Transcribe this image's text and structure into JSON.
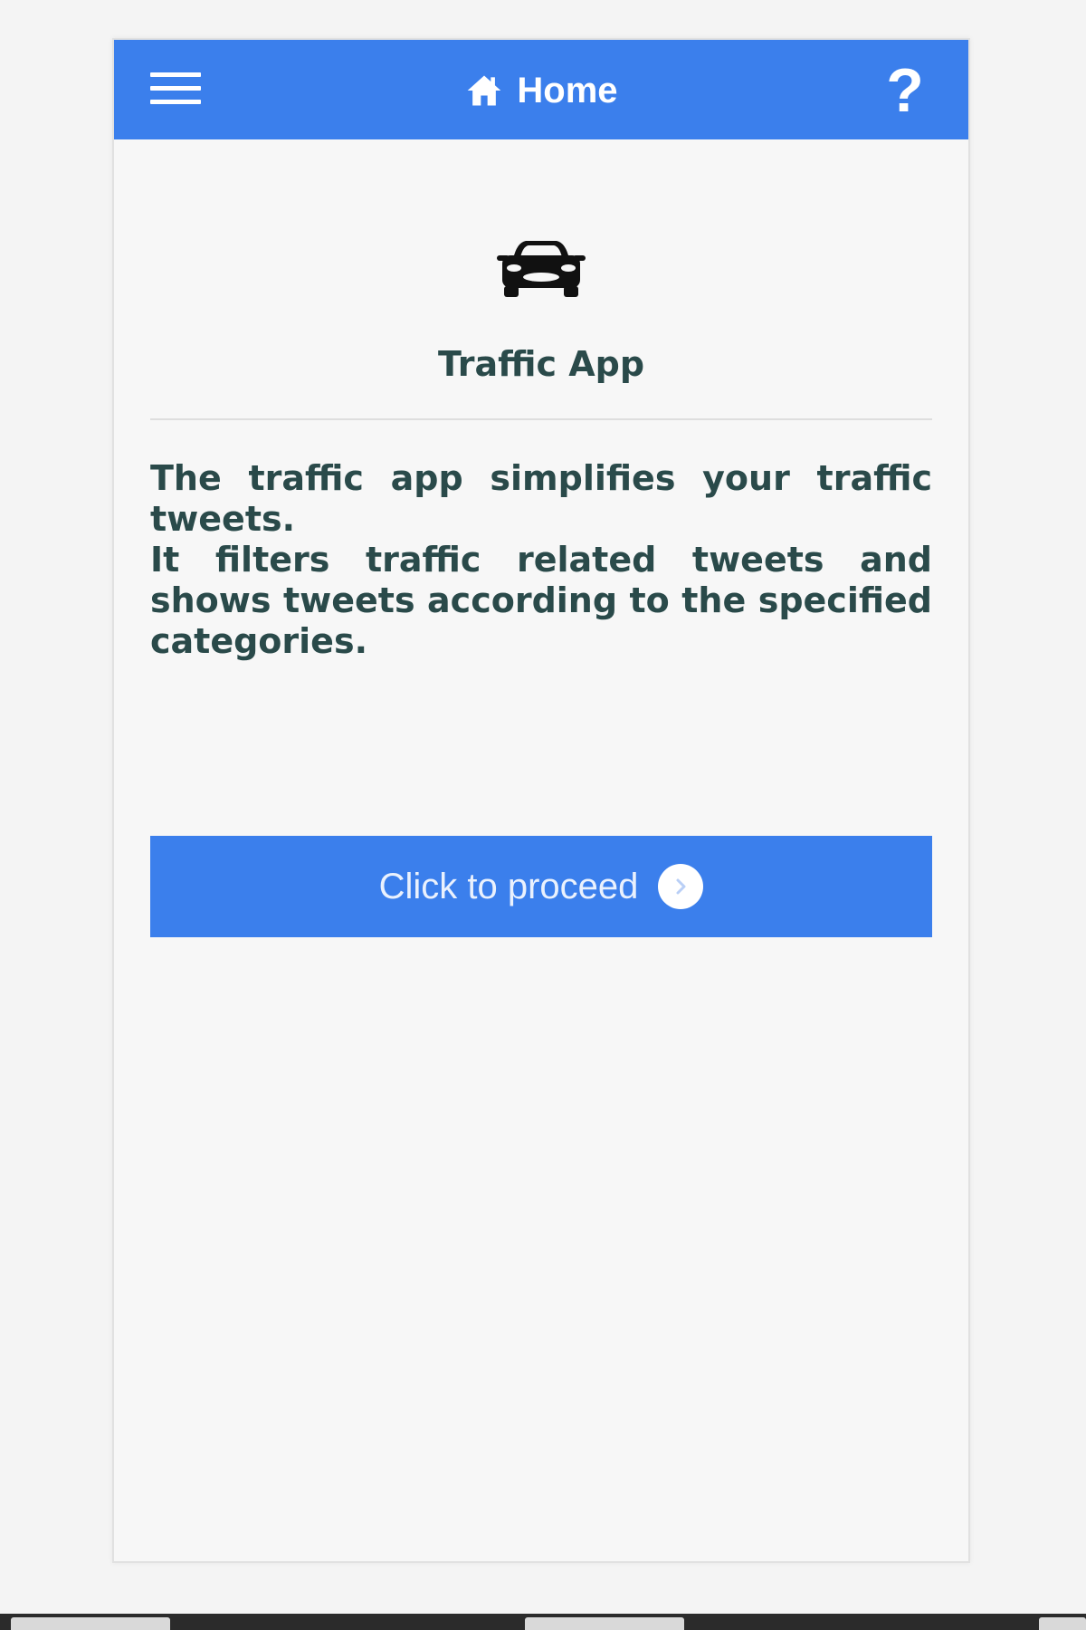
{
  "header": {
    "menu_icon": "hamburger-menu-icon",
    "home_icon": "home-icon",
    "title": "Home",
    "help_label": "?"
  },
  "main": {
    "app_icon": "car-icon",
    "app_title": "Traffic App",
    "description_lines": [
      "The traffic app simplifies your traffic tweets.",
      "It filters traffic related tweets and shows tweets according to the specified categories."
    ],
    "proceed_button": {
      "label": "Click to proceed",
      "icon": "arrow-right-circle-icon"
    }
  },
  "colors": {
    "primary": "#3b7fec",
    "text": "#2a4a4a",
    "background": "#f7f7f7"
  }
}
